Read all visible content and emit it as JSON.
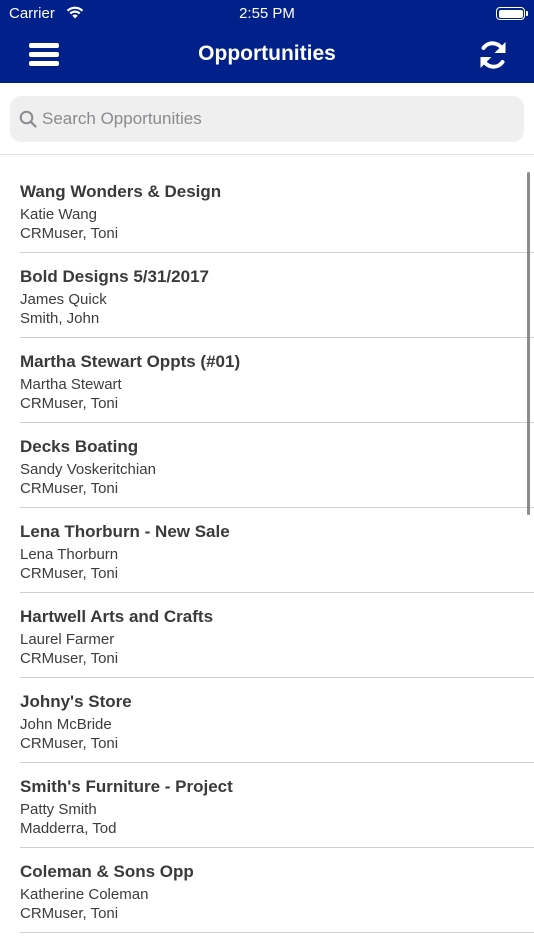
{
  "status_bar": {
    "carrier": "Carrier",
    "time": "2:55 PM"
  },
  "nav": {
    "title": "Opportunities",
    "menu_icon": "hamburger-menu-icon",
    "refresh_icon": "refresh-icon",
    "background_color": "#00208a"
  },
  "search": {
    "placeholder": "Search Opportunities",
    "value": ""
  },
  "opportunities": [
    {
      "title": "Wang Wonders & Design",
      "contact": "Katie Wang",
      "owner": "CRMuser, Toni"
    },
    {
      "title": "Bold Designs 5/31/2017",
      "contact": "James Quick",
      "owner": "Smith, John"
    },
    {
      "title": "Martha Stewart Oppts (#01)",
      "contact": "Martha Stewart",
      "owner": "CRMuser, Toni"
    },
    {
      "title": "Decks Boating",
      "contact": "Sandy Voskeritchian",
      "owner": "CRMuser, Toni"
    },
    {
      "title": "Lena Thorburn - New Sale",
      "contact": "Lena Thorburn",
      "owner": "CRMuser, Toni"
    },
    {
      "title": "Hartwell Arts and Crafts",
      "contact": "Laurel Farmer",
      "owner": "CRMuser, Toni"
    },
    {
      "title": "Johny's Store",
      "contact": "John McBride",
      "owner": "CRMuser, Toni"
    },
    {
      "title": "Smith's Furniture - Project",
      "contact": "Patty Smith",
      "owner": "Madderra, Tod"
    },
    {
      "title": "Coleman & Sons Opp",
      "contact": "Katherine Coleman",
      "owner": "CRMuser, Toni"
    }
  ]
}
